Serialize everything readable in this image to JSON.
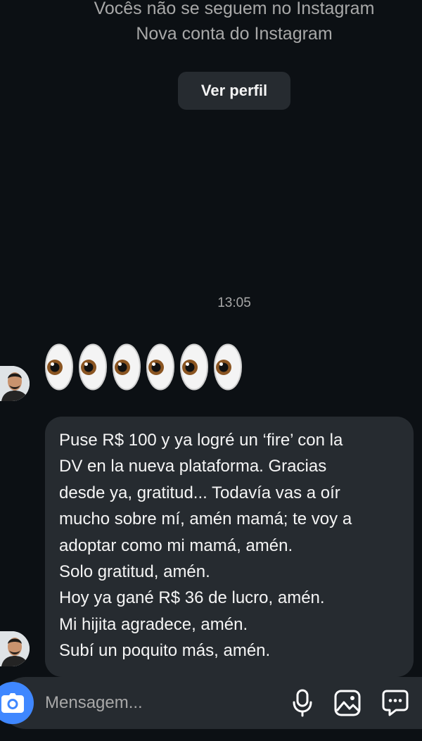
{
  "header": {
    "follow_status": "Vocês não se seguem no Instagram",
    "account_note": "Nova conta do Instagram",
    "view_profile_label": "Ver perfil"
  },
  "timestamp": "13:05",
  "messages": [
    {
      "type": "emoji",
      "content": "👀👀👀",
      "icon": "eyes-emoji"
    },
    {
      "type": "text",
      "lines": [
        "Puse R$ 100 y ya logré un ‘fire’ con la",
        "DV en la nueva plataforma. Gracias",
        "desde ya, gratitud... Todavía vas a oír",
        "mucho sobre mí, amén mamá; te voy a",
        "adoptar como mi mamá, amén.",
        "Solo gratitud, amén.",
        "Hoy ya gané R$ 36 de lucro, amén.",
        "Mi hijita agradece, amén.",
        "Subí un poquito más, amén."
      ]
    }
  ],
  "composer": {
    "placeholder": "Mensagem...",
    "icons": [
      "camera-icon",
      "microphone-icon",
      "gallery-icon",
      "sticker-icon"
    ]
  },
  "colors": {
    "background": "#0c1014",
    "bubble": "#262b30",
    "muted_text": "#a8a8a8",
    "accent": "#3f87ff"
  }
}
